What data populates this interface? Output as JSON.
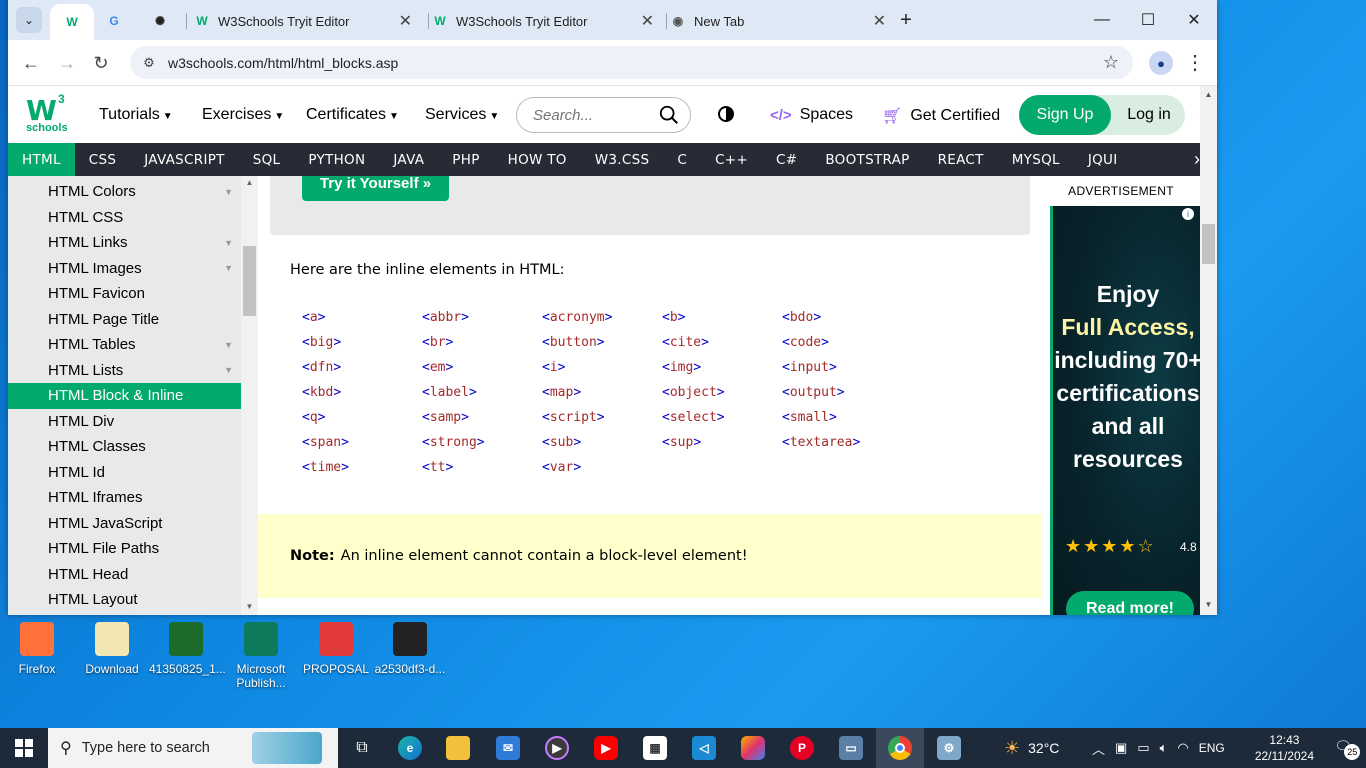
{
  "desktop": {
    "icons": [
      {
        "label": "Firefox",
        "color": "#ff7139"
      },
      {
        "label": "Download",
        "color": "#f3e6b5"
      },
      {
        "label": "41350825_1...",
        "color": "#1b6b2a"
      },
      {
        "label": "Microsoft Publish...",
        "color": "#0e7a5c"
      },
      {
        "label": "PROPOSAL",
        "color": "#e23a3a"
      },
      {
        "label": "a2530df3-d...",
        "color": "#222222"
      }
    ]
  },
  "browser": {
    "tabs": [
      {
        "title": "",
        "icon": "w3schools-icon",
        "active": true
      },
      {
        "title": "",
        "icon": "google-icon"
      },
      {
        "title": "",
        "icon": "chatgpt-icon"
      },
      {
        "title": "W3Schools Tryit Editor",
        "icon": "w3schools-icon"
      },
      {
        "title": "W3Schools Tryit Editor",
        "icon": "w3schools-icon"
      },
      {
        "title": "New Tab",
        "icon": "chrome-icon"
      }
    ],
    "url": "w3schools.com/html/html_blocks.asp"
  },
  "header": {
    "logo_mark": "W",
    "logo_sup": "3",
    "logo_text": "schools",
    "menu": [
      "Tutorials",
      "Exercises",
      "Certificates",
      "Services"
    ],
    "search_placeholder": "Search...",
    "spaces": "Spaces",
    "get_certified": "Get Certified",
    "sign_up": "Sign Up",
    "log_in": "Log in"
  },
  "topnav": [
    "HTML",
    "CSS",
    "JAVASCRIPT",
    "SQL",
    "PYTHON",
    "JAVA",
    "PHP",
    "HOW TO",
    "W3.CSS",
    "C",
    "C++",
    "C#",
    "BOOTSTRAP",
    "REACT",
    "MYSQL",
    "JQUI"
  ],
  "sidebar": [
    {
      "label": "HTML Colors",
      "chev": true
    },
    {
      "label": "HTML CSS"
    },
    {
      "label": "HTML Links",
      "chev": true
    },
    {
      "label": "HTML Images",
      "chev": true
    },
    {
      "label": "HTML Favicon"
    },
    {
      "label": "HTML Page Title"
    },
    {
      "label": "HTML Tables",
      "chev": true
    },
    {
      "label": "HTML Lists",
      "chev": true
    },
    {
      "label": "HTML Block & Inline",
      "active": true
    },
    {
      "label": "HTML Div"
    },
    {
      "label": "HTML Classes"
    },
    {
      "label": "HTML Id"
    },
    {
      "label": "HTML Iframes"
    },
    {
      "label": "HTML JavaScript"
    },
    {
      "label": "HTML File Paths"
    },
    {
      "label": "HTML Head"
    },
    {
      "label": "HTML Layout"
    }
  ],
  "main": {
    "try_it": "Try it Yourself »",
    "intro": "Here are the inline elements in HTML:",
    "inline_elements": [
      [
        "a",
        "abbr",
        "acronym",
        "b",
        "bdo"
      ],
      [
        "big",
        "br",
        "button",
        "cite",
        "code"
      ],
      [
        "dfn",
        "em",
        "i",
        "img",
        "input"
      ],
      [
        "kbd",
        "label",
        "map",
        "object",
        "output"
      ],
      [
        "q",
        "samp",
        "script",
        "select",
        "small"
      ],
      [
        "span",
        "strong",
        "sub",
        "sup",
        "textarea"
      ],
      [
        "time",
        "tt",
        "var"
      ]
    ],
    "note_label": "Note:",
    "note_text": "An inline element cannot contain a block-level element!"
  },
  "ad": {
    "label": "ADVERTISEMENT",
    "line1": "Enjoy",
    "highlight": "Full Access,",
    "line3": "including 70+ certifications and all resources",
    "stars": "★★★★☆",
    "rating": "4.8",
    "button": "Read more!"
  },
  "taskbar": {
    "search_placeholder": "Type here to search",
    "weather": "32°C",
    "lang": "ENG",
    "time": "12:43",
    "date": "22/11/2024",
    "notifications": "25"
  }
}
